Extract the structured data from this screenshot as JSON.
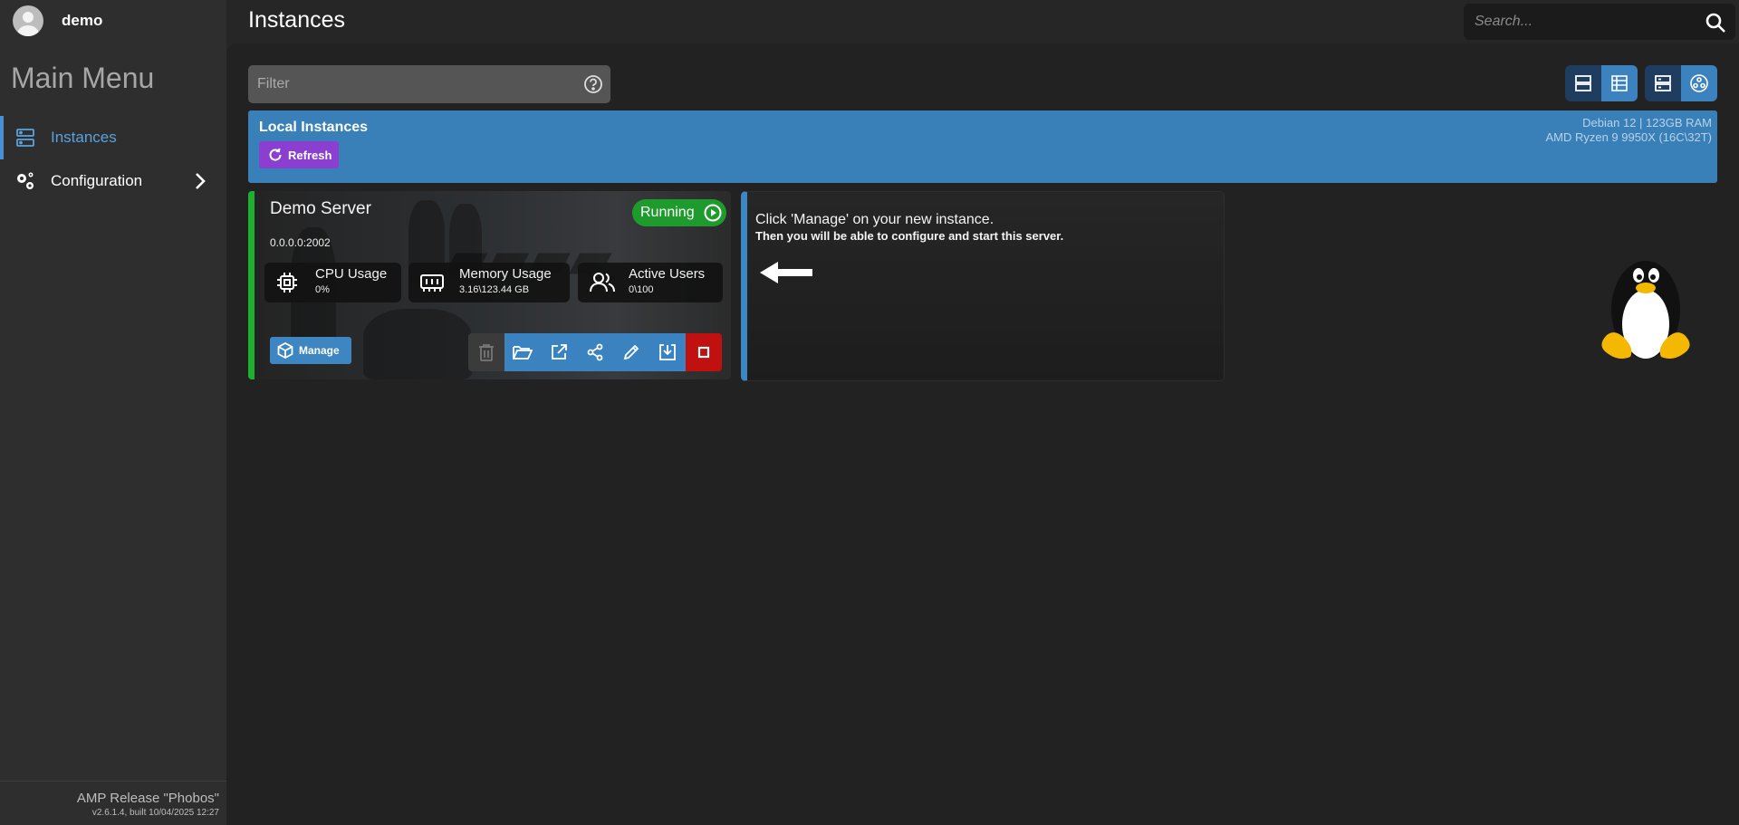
{
  "user": {
    "name": "demo"
  },
  "sidebar": {
    "title": "Main Menu",
    "items": [
      {
        "label": "Instances",
        "icon": "server-icon",
        "active": true
      },
      {
        "label": "Configuration",
        "icon": "gears-icon",
        "active": false
      }
    ],
    "footer": {
      "release": "AMP Release \"Phobos\"",
      "version": "v2.6.1.4, built 10/04/2025 12:27"
    }
  },
  "header": {
    "title": "Instances",
    "search_placeholder": "Search..."
  },
  "filter": {
    "placeholder": "Filter"
  },
  "local_instances": {
    "title": "Local Instances",
    "refresh_label": "Refresh",
    "system_os": "Debian  12 | 123GB RAM",
    "system_cpu": "AMD Ryzen 9 9950X (16C\\32T)",
    "accent_color": "#3a80b8"
  },
  "instance": {
    "name": "Demo Server",
    "address": "0.0.0.0:2002",
    "status": "Running",
    "status_color": "#1f9a2c",
    "stats": [
      {
        "label": "CPU Usage",
        "value": "0%",
        "icon": "cpu-icon"
      },
      {
        "label": "Memory Usage",
        "value": "3.16\\123.44 GB",
        "icon": "memory-icon"
      },
      {
        "label": "Active Users",
        "value": "0\\100",
        "icon": "users-icon"
      }
    ],
    "manage_label": "Manage",
    "actions": [
      "delete-icon",
      "folder-icon",
      "open-external-icon",
      "share-icon",
      "edit-icon",
      "download-icon",
      "stop-icon"
    ]
  },
  "hint": {
    "title": "Click 'Manage' on your new instance.",
    "subtitle": "Then you will be able to configure and start this server."
  }
}
